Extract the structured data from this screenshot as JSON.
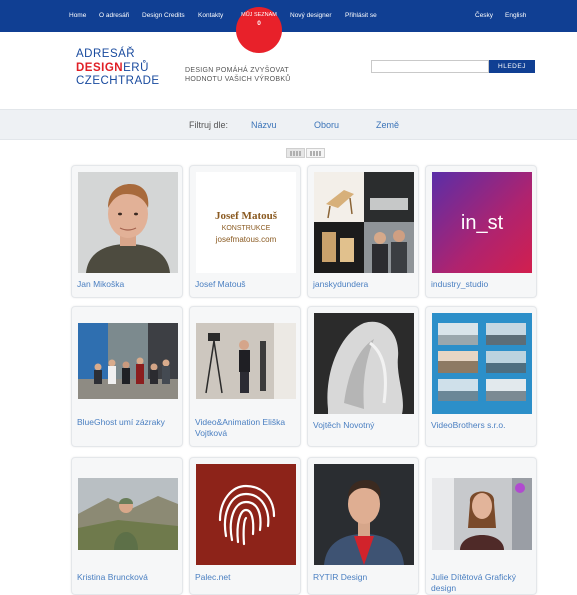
{
  "nav": {
    "home": "Home",
    "about": "O adresáři",
    "credits": "Design Credits",
    "contacts": "Kontakty",
    "new_designer": "Nový designer",
    "login": "Přihlásit se",
    "lang_cz": "Česky",
    "lang_en": "English"
  },
  "badge": {
    "title": "MŮJ SEZNAM",
    "count": "0"
  },
  "header": {
    "logo_line1": "ADRESÁŘ",
    "logo_red": "DESIGN",
    "logo_blue": "ERŮ",
    "logo_line3": "CZECHTRADE",
    "tagline_1": "DESIGN POMÁHÁ ZVYŠOVAT",
    "tagline_2": "HODNOTU VAŠICH VÝROBKŮ"
  },
  "search": {
    "value": "",
    "button": "HLEDEJ"
  },
  "filter": {
    "label": "Filtruj dle:",
    "by_name": "Názvu",
    "by_field": "Oboru",
    "by_country": "Země"
  },
  "josef_logo": {
    "line1": "Josef Matouš",
    "line2": "KONSTRUKCE",
    "line3": "josefmatous.com"
  },
  "industry_logo": "in_st",
  "cards": [
    {
      "name": "Jan Mikoška"
    },
    {
      "name": "Josef Matouš"
    },
    {
      "name": "janskydundera"
    },
    {
      "name": "industry_studio"
    },
    {
      "name": "BlueGhost umí zázraky"
    },
    {
      "name": "Video&Animation Eliška Vojtková"
    },
    {
      "name": "Vojtěch Novotný"
    },
    {
      "name": "VideoBrothers s.r.o."
    },
    {
      "name": "Kristina Bruncková"
    },
    {
      "name": "Palec.net"
    },
    {
      "name": "RYTIR Design"
    },
    {
      "name": "Julie Dítětová Grafický design"
    }
  ],
  "colors": {
    "nav_bg": "#103f93",
    "accent_red": "#e8212a",
    "link_blue": "#4a7fc1"
  }
}
